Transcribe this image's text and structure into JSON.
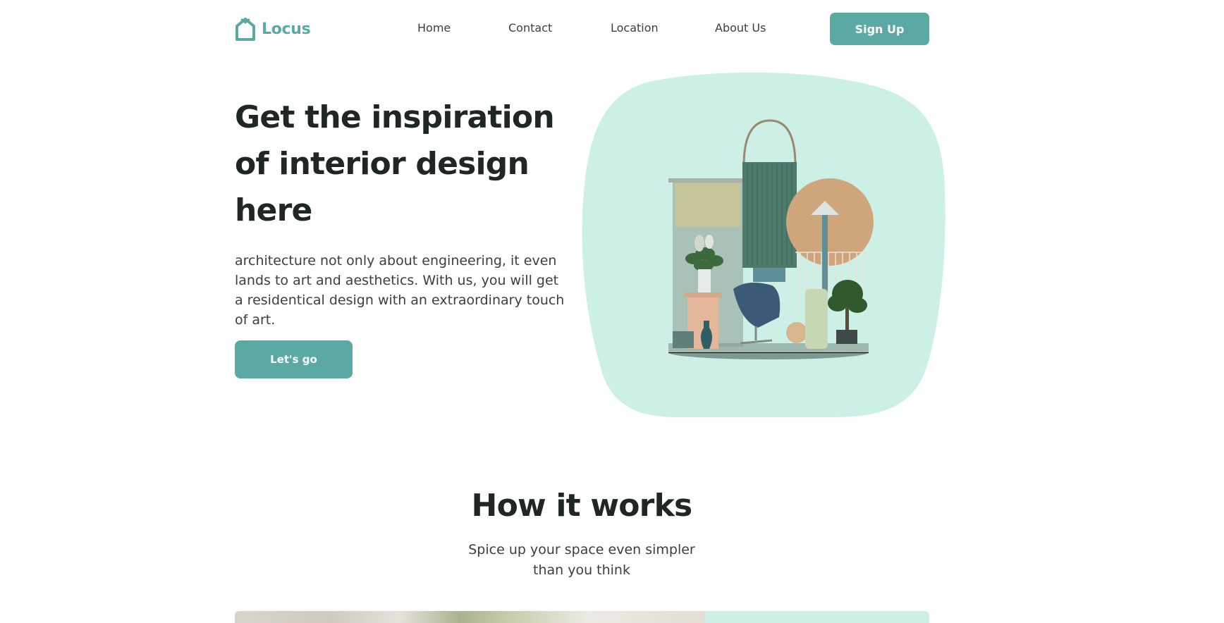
{
  "brand": {
    "name": "Locus",
    "accent": "#5aa9a3",
    "mint": "#cdf0e6"
  },
  "nav": {
    "items": [
      {
        "label": "Home"
      },
      {
        "label": "Contact"
      },
      {
        "label": "Location"
      },
      {
        "label": "About Us"
      }
    ],
    "signup_label": "Sign Up"
  },
  "hero": {
    "title_lines": [
      "Get the inspiration",
      "of interior design",
      "here"
    ],
    "description": "architecture not only about engineering, it even lands to art and aesthetics. With us, you will get a residentical design with an extraordinary touch of art.",
    "description_lines": [
      "architecture not only about engineering, it even",
      "lands to art and aesthetics. With us, you will get",
      "a residentical design with an extraordinary touch",
      "of art."
    ],
    "cta_label": "Let's go"
  },
  "how_it_works": {
    "title": "How it works",
    "subtitle_lines": [
      "Spice up your space even simpler",
      "than you think"
    ]
  }
}
